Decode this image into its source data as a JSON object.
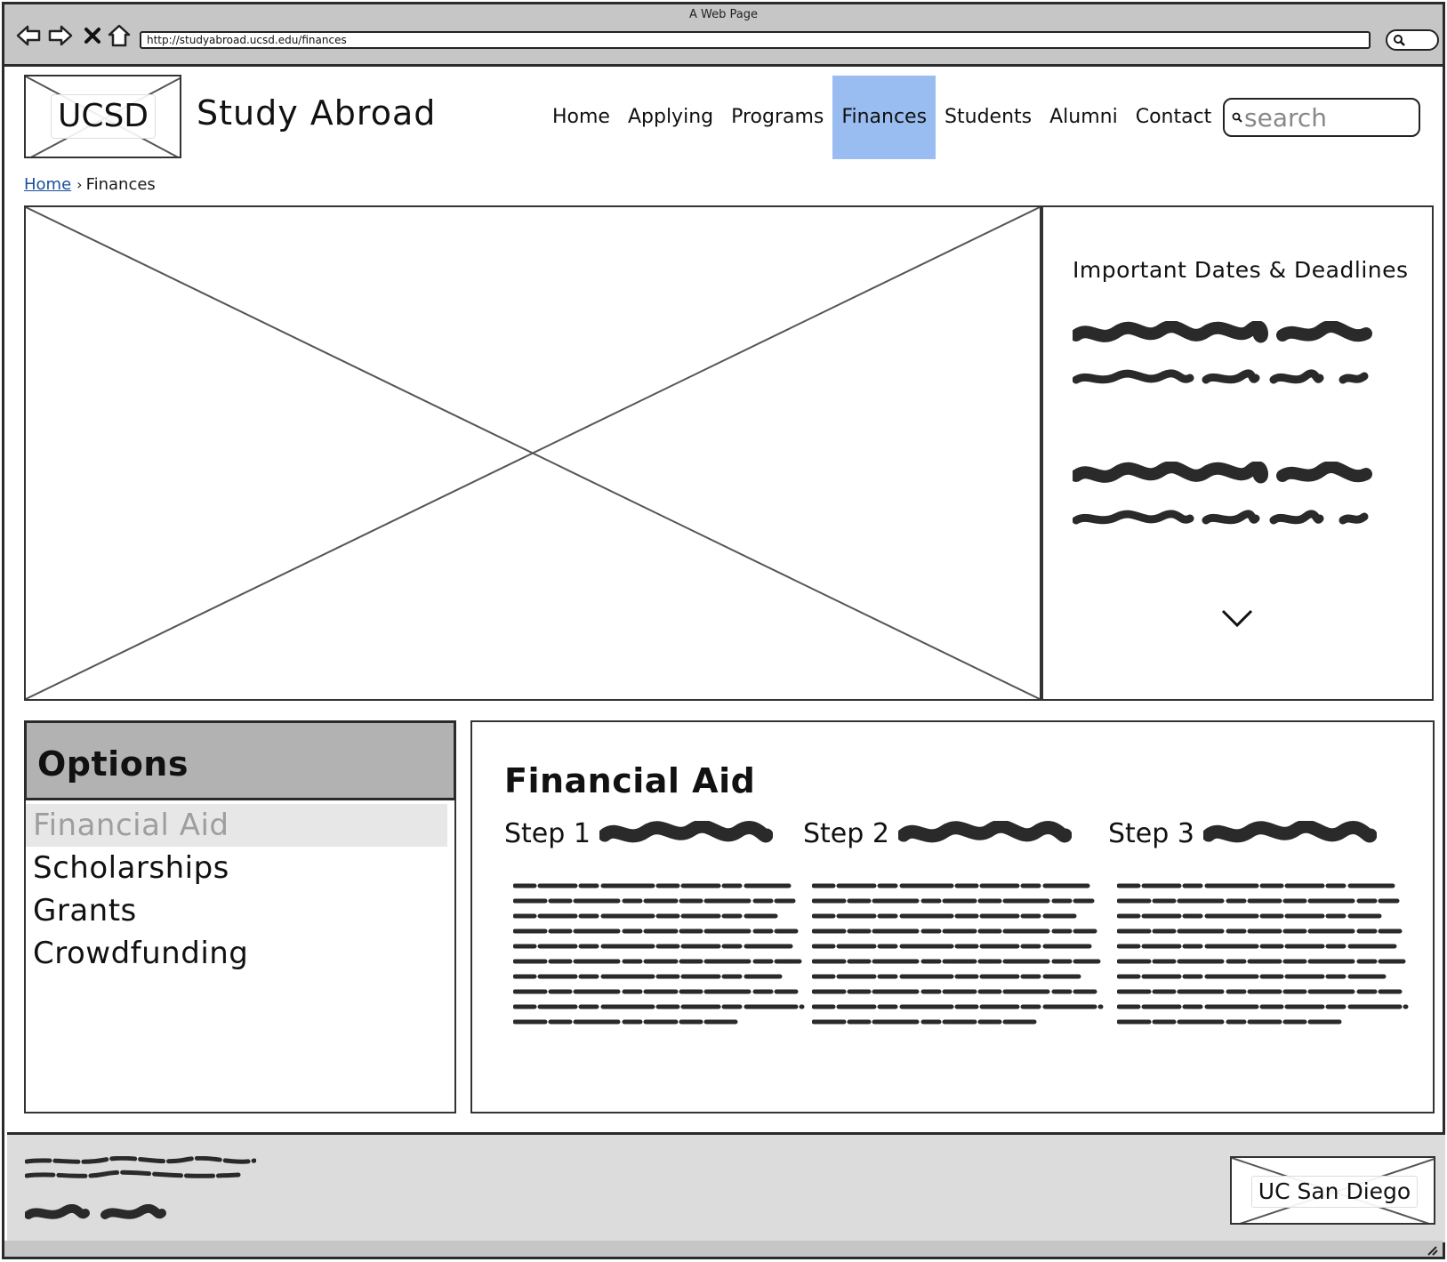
{
  "browser": {
    "window_title": "A Web Page",
    "url": "http://studyabroad.ucsd.edu/finances",
    "icons": [
      "back-icon",
      "forward-icon",
      "close-icon",
      "home-icon",
      "search-icon"
    ]
  },
  "header": {
    "logo_text": "UCSD",
    "site_title": "Study Abroad",
    "nav": [
      {
        "label": "Home",
        "active": false
      },
      {
        "label": "Applying",
        "active": false
      },
      {
        "label": "Programs",
        "active": false
      },
      {
        "label": "Finances",
        "active": true
      },
      {
        "label": "Students",
        "active": false
      },
      {
        "label": "Alumni",
        "active": false
      },
      {
        "label": "Contact",
        "active": false
      }
    ],
    "search_placeholder": "search",
    "active_color": "#99bdf1"
  },
  "breadcrumb": {
    "home": "Home",
    "current": "Finances"
  },
  "deadlines": {
    "title": "Important Dates & Deadlines"
  },
  "options": {
    "title": "Options",
    "items": [
      {
        "label": "Financial Aid",
        "selected": true
      },
      {
        "label": "Scholarships",
        "selected": false
      },
      {
        "label": "Grants",
        "selected": false
      },
      {
        "label": "Crowdfunding",
        "selected": false
      }
    ]
  },
  "content": {
    "title": "Financial Aid",
    "steps": [
      {
        "label": "Step 1"
      },
      {
        "label": "Step 2"
      },
      {
        "label": "Step 3"
      }
    ]
  },
  "footer": {
    "logo_text": "UC San Diego"
  }
}
